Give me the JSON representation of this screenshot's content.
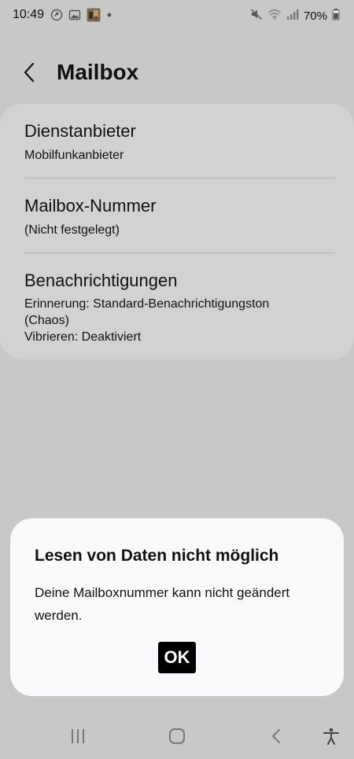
{
  "status_bar": {
    "time": "10:49",
    "battery_percent": "70%",
    "left_icons": [
      "call-forwarding-icon",
      "gallery-icon",
      "app-thumbnail-icon",
      "notification-dot-icon"
    ],
    "right_icons": [
      "mute-icon",
      "wifi-icon",
      "signal-icon",
      "battery-icon"
    ]
  },
  "header": {
    "title": "Mailbox",
    "back_icon": "back-arrow-icon"
  },
  "settings": {
    "items": [
      {
        "title": "Dienstanbieter",
        "subtitle_lines": [
          "Mobilfunkanbieter"
        ]
      },
      {
        "title": "Mailbox-Nummer",
        "subtitle_lines": [
          "(Nicht festgelegt)"
        ]
      },
      {
        "title": "Benachrichtigungen",
        "subtitle_lines": [
          "Erinnerung: Standard-Benachrichtigungston",
          "(Chaos)",
          "Vibrieren: Deaktiviert"
        ]
      }
    ]
  },
  "dialog": {
    "title": "Lesen von Daten nicht möglich",
    "message": "Deine Mailboxnummer kann nicht geändert werden.",
    "ok_label": "OK"
  },
  "nav_bar": {
    "icons": [
      "recent-apps-icon",
      "home-icon",
      "back-icon",
      "accessibility-icon"
    ]
  },
  "colors": {
    "background": "#c8c8c8",
    "card": "#d2d2d2",
    "dialog": "#fafafc",
    "ok_button": "#000000",
    "text": "#111111"
  }
}
